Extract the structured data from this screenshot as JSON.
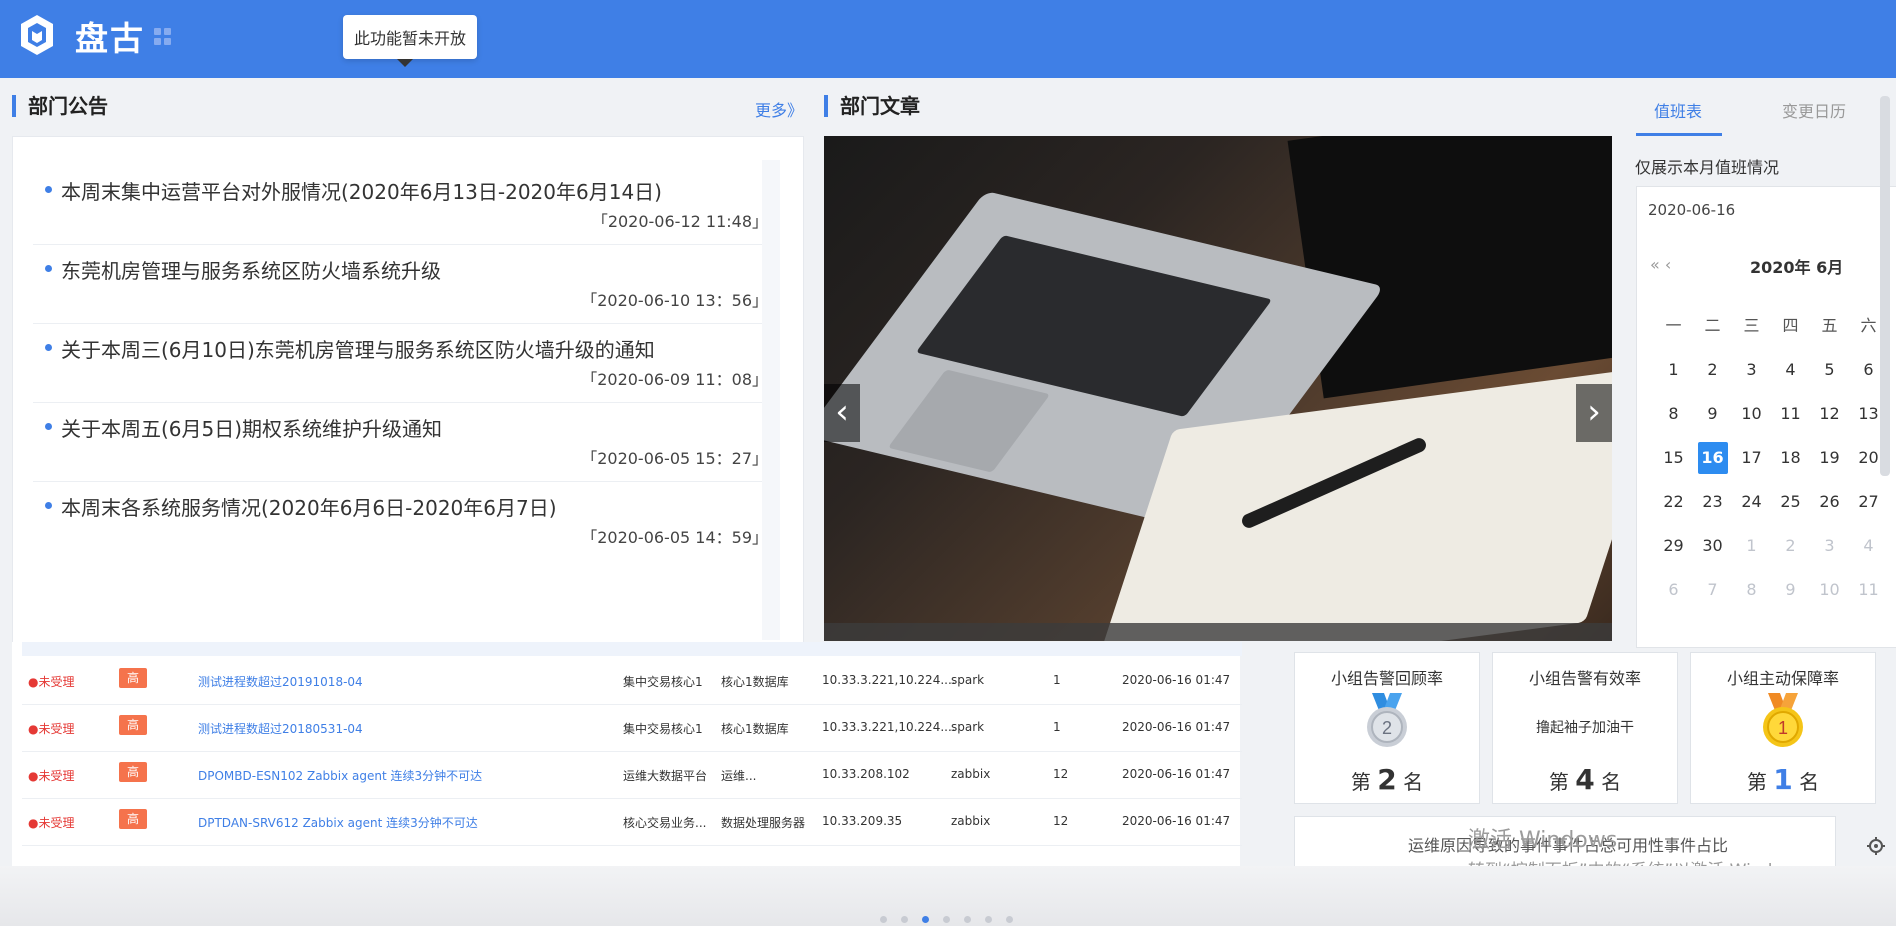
{
  "header": {
    "brand": "盘古",
    "tooltip": "此功能暂未开放",
    "accent": "#3f7fe6"
  },
  "notice": {
    "title": "部门公告",
    "more": "更多》",
    "items": [
      {
        "title": "本周末集中运营平台对外服情况(2020年6月13日-2020年6月14日)",
        "date": "「2020-06-12 11:48」"
      },
      {
        "title": "东莞机房管理与服务系统区防火墙系统升级",
        "date": "「2020-06-10 13：56」"
      },
      {
        "title": "关于本周三(6月10日)东莞机房管理与服务系统区防火墙升级的通知",
        "date": "「2020-06-09 11：08」"
      },
      {
        "title": "关于本周五(6月5日)期权系统维护升级通知",
        "date": "「2020-06-05 15：27」"
      },
      {
        "title": "本周末各系统服务情况(2020年6月6日-2020年6月7日)",
        "date": "「2020-06-05 14：59」"
      }
    ]
  },
  "article": {
    "title": "部门文章",
    "prev": "‹",
    "next": "›"
  },
  "duty": {
    "tab_active": "值班表",
    "tab_other": "变更日历",
    "label": "仅展示本月值班情况",
    "date_value": "2020-06-16",
    "nav": "«  ‹",
    "month_title": "2020年 6月",
    "weekdays": [
      "一",
      "二",
      "三",
      "四",
      "五",
      "六"
    ],
    "weeks": [
      [
        "1",
        "2",
        "3",
        "4",
        "5",
        "6"
      ],
      [
        "8",
        "9",
        "10",
        "11",
        "12",
        "13"
      ],
      [
        "15",
        "16",
        "17",
        "18",
        "19",
        "20"
      ],
      [
        "22",
        "23",
        "24",
        "25",
        "26",
        "27"
      ],
      [
        "29",
        "30",
        "1",
        "2",
        "3",
        "4"
      ],
      [
        "6",
        "7",
        "8",
        "9",
        "10",
        "11"
      ]
    ],
    "today": "16"
  },
  "alarms": [
    {
      "status": "●未受理",
      "level": "高",
      "title": "测试进程数超过20191018-04",
      "sys": "集中交易核心1",
      "obj": "核心1数据库",
      "ip": "10.33.3.221,10.224....",
      "user": "spark",
      "count": "1",
      "time": "2020-06-16 01:47"
    },
    {
      "status": "●未受理",
      "level": "高",
      "title": "测试进程数超过20180531-04",
      "sys": "集中交易核心1",
      "obj": "核心1数据库",
      "ip": "10.33.3.221,10.224....",
      "user": "spark",
      "count": "1",
      "time": "2020-06-16 01:47"
    },
    {
      "status": "●未受理",
      "level": "高",
      "title": "DPOMBD-ESN102 Zabbix agent 连续3分钟不可达",
      "sys": "运维大数据平台",
      "obj": "运维...",
      "ip": "10.33.208.102",
      "user": "zabbix",
      "count": "12",
      "time": "2020-06-16 01:47"
    },
    {
      "status": "●未受理",
      "level": "高",
      "title": "DPTDAN-SRV612 Zabbix agent 连续3分钟不可达",
      "sys": "核心交易业务...",
      "obj": "数据处理服务器",
      "ip": "10.33.209.35",
      "user": "zabbix",
      "count": "12",
      "time": "2020-06-16 01:47"
    }
  ],
  "stats": [
    {
      "title": "小组告警回顾率",
      "rank_prefix": "第",
      "rank": "2",
      "rank_suffix": "名",
      "medal": "2"
    },
    {
      "title": "小组告警有效率",
      "text": "撸起袖子加油干",
      "rank_prefix": "第",
      "rank": "4",
      "rank_suffix": "名"
    },
    {
      "title": "小组主动保障率",
      "rank_prefix": "第",
      "rank": "1",
      "rank_suffix": "名",
      "medal": "1"
    }
  ],
  "bottom_card": {
    "text": "运维原因导致的事件事件占总可用性事件占比"
  },
  "windows_watermark": {
    "line1": "激活 Windows",
    "line2": "转到“控制面板”中的“系统”以激活 Windows。"
  }
}
